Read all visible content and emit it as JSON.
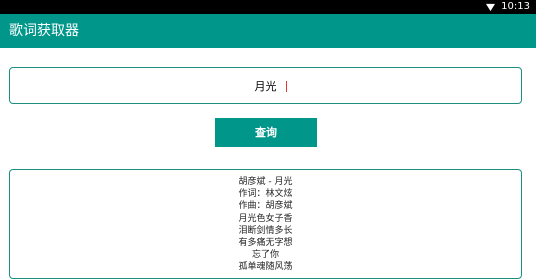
{
  "status_bar": {
    "time": "10:13",
    "wifi_icon": "wifi-icon"
  },
  "app_bar": {
    "title": "歌词获取器",
    "color": "#00968a"
  },
  "search": {
    "value": "月光",
    "cursor_color": "#e53935"
  },
  "query_button": {
    "label": "查询"
  },
  "lyrics": {
    "lines": [
      "胡彦斌 - 月光",
      "作词：林文炫",
      "作曲：胡彦斌",
      "月光色女子香",
      "泪断剑情多长",
      "有多痛无字想",
      "忘了你",
      "孤单魂随风荡"
    ]
  }
}
